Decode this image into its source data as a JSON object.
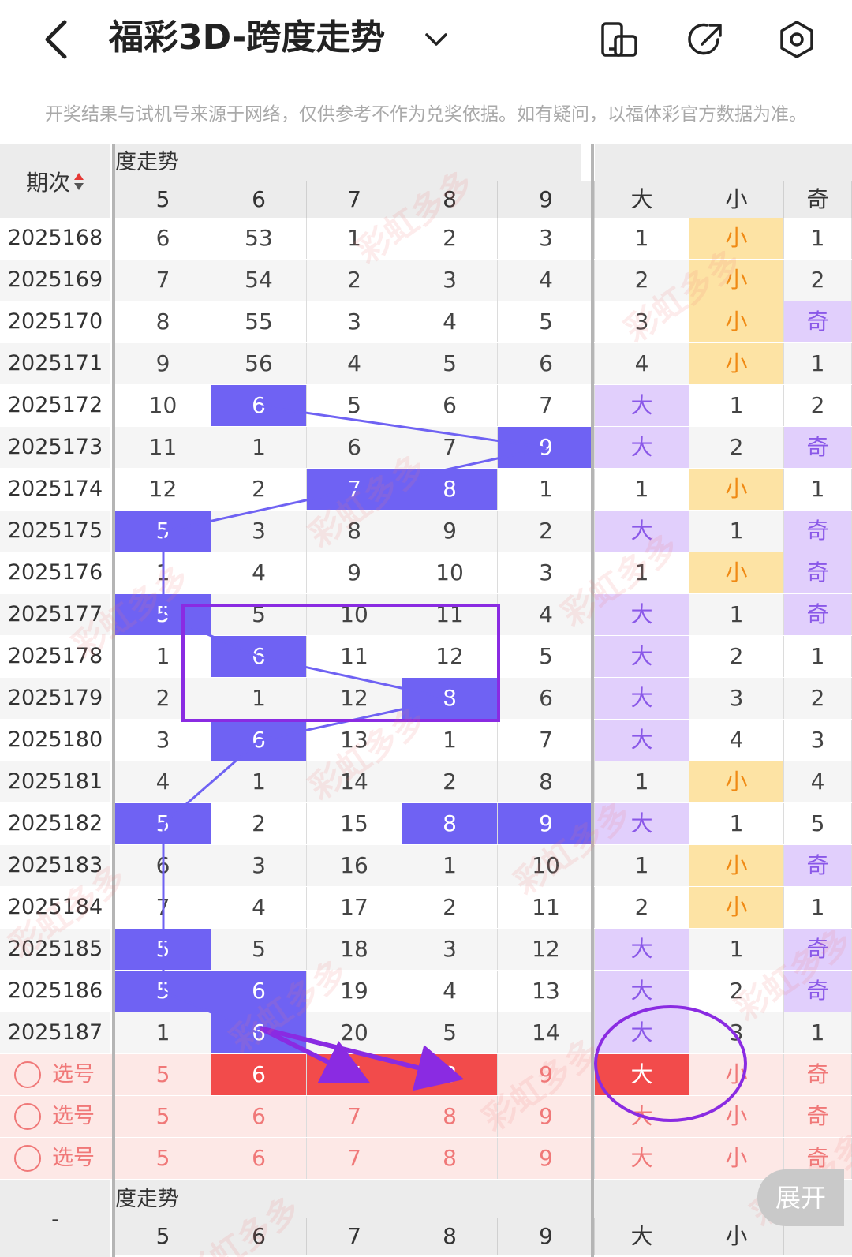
{
  "header": {
    "title": "福彩3D-跨度走势",
    "notice": "开奖结果与试机号来源于网络，仅供参考不作为兑奖依据。如有疑问，以福体彩官方数据为准。"
  },
  "table": {
    "issue_header": "期次",
    "section_label": "度走势",
    "columns": [
      "5",
      "6",
      "7",
      "8",
      "9",
      "大",
      "小",
      "奇"
    ],
    "rows": [
      {
        "issue": "2025168",
        "cells": [
          "6",
          "53",
          "1",
          "2",
          "3",
          "1",
          "小",
          "1"
        ]
      },
      {
        "issue": "2025169",
        "cells": [
          "7",
          "54",
          "2",
          "3",
          "4",
          "2",
          "小",
          "2"
        ]
      },
      {
        "issue": "2025170",
        "cells": [
          "8",
          "55",
          "3",
          "4",
          "5",
          "3",
          "小",
          "奇"
        ]
      },
      {
        "issue": "2025171",
        "cells": [
          "9",
          "56",
          "4",
          "5",
          "6",
          "4",
          "小",
          "1"
        ]
      },
      {
        "issue": "2025172",
        "cells": [
          "10",
          "6",
          "5",
          "6",
          "7",
          "大",
          "1",
          "2"
        ]
      },
      {
        "issue": "2025173",
        "cells": [
          "11",
          "1",
          "6",
          "7",
          "9",
          "大",
          "2",
          "奇"
        ]
      },
      {
        "issue": "2025174",
        "cells": [
          "12",
          "2",
          "7",
          "8",
          "1",
          "1",
          "小",
          "1"
        ]
      },
      {
        "issue": "2025175",
        "cells": [
          "5",
          "3",
          "8",
          "9",
          "2",
          "大",
          "1",
          "奇"
        ]
      },
      {
        "issue": "2025176",
        "cells": [
          "1",
          "4",
          "9",
          "10",
          "3",
          "1",
          "小",
          "奇"
        ]
      },
      {
        "issue": "2025177",
        "cells": [
          "5",
          "5",
          "10",
          "11",
          "4",
          "大",
          "1",
          "奇"
        ]
      },
      {
        "issue": "2025178",
        "cells": [
          "1",
          "6",
          "11",
          "12",
          "5",
          "大",
          "2",
          "1"
        ]
      },
      {
        "issue": "2025179",
        "cells": [
          "2",
          "1",
          "12",
          "8",
          "6",
          "大",
          "3",
          "2"
        ]
      },
      {
        "issue": "2025180",
        "cells": [
          "3",
          "6",
          "13",
          "1",
          "7",
          "大",
          "4",
          "3"
        ]
      },
      {
        "issue": "2025181",
        "cells": [
          "4",
          "1",
          "14",
          "2",
          "8",
          "1",
          "小",
          "4"
        ]
      },
      {
        "issue": "2025182",
        "cells": [
          "5",
          "2",
          "15",
          "8",
          "9",
          "大",
          "1",
          "5"
        ]
      },
      {
        "issue": "2025183",
        "cells": [
          "6",
          "3",
          "16",
          "1",
          "10",
          "1",
          "小",
          "奇"
        ]
      },
      {
        "issue": "2025184",
        "cells": [
          "7",
          "4",
          "17",
          "2",
          "11",
          "2",
          "小",
          "1"
        ]
      },
      {
        "issue": "2025185",
        "cells": [
          "5",
          "5",
          "18",
          "3",
          "12",
          "大",
          "1",
          "奇"
        ]
      },
      {
        "issue": "2025186",
        "cells": [
          "5",
          "6",
          "19",
          "4",
          "13",
          "大",
          "2",
          "奇"
        ]
      },
      {
        "issue": "2025187",
        "cells": [
          "1",
          "6",
          "20",
          "5",
          "14",
          "大",
          "3",
          "1"
        ]
      }
    ],
    "pick_rows": [
      {
        "label": "选号",
        "cells": [
          "5",
          "6",
          "7",
          "8",
          "9",
          "大",
          "小",
          "奇"
        ]
      },
      {
        "label": "选号",
        "cells": [
          "5",
          "6",
          "7",
          "8",
          "9",
          "大",
          "小",
          "奇"
        ]
      },
      {
        "label": "选号",
        "cells": [
          "5",
          "6",
          "7",
          "8",
          "9",
          "大",
          "小",
          "奇"
        ]
      }
    ],
    "footer_issue": "-",
    "footer_section_label": "度走势",
    "footer_columns": [
      "5",
      "6",
      "7",
      "8",
      "9",
      "大",
      "小"
    ]
  },
  "watermark": "彩虹多多",
  "expand_button": "展开"
}
